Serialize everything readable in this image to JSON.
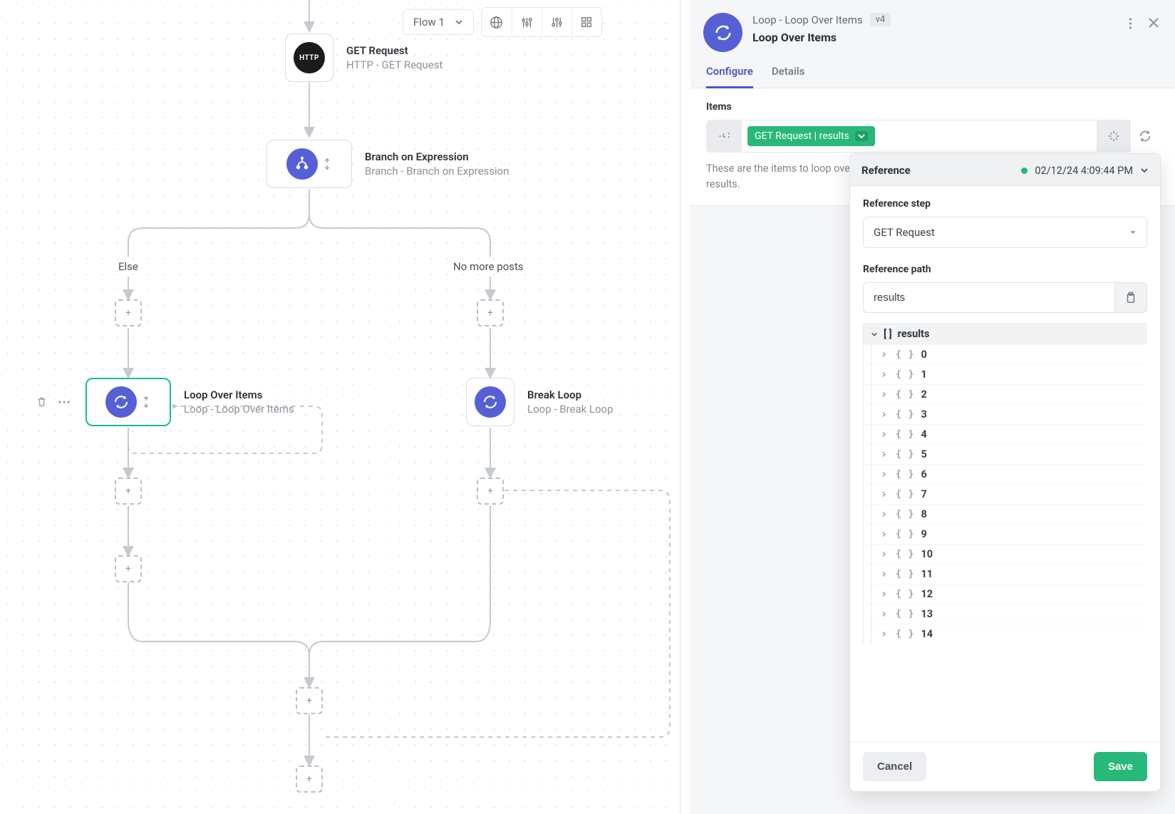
{
  "toolbar": {
    "flow_label": "Flow 1"
  },
  "nodes": {
    "http": {
      "title": "GET Request",
      "sub": "HTTP - GET Request",
      "icon_text": "HTTP"
    },
    "branch": {
      "title": "Branch on Expression",
      "sub": "Branch - Branch on Expression"
    },
    "loop": {
      "title": "Loop Over Items",
      "sub": "Loop - Loop Over Items"
    },
    "break": {
      "title": "Break Loop",
      "sub": "Loop - Break Loop"
    }
  },
  "branch_labels": {
    "else": "Else",
    "no_more": "No more posts"
  },
  "panel": {
    "crumb": "Loop - Loop Over Items",
    "version": "v4",
    "title": "Loop Over Items",
    "tabs": {
      "configure": "Configure",
      "details": "Details"
    },
    "items_label": "Items",
    "items_pill": "GET Request | results",
    "helper": "These are the items to loop over. This is usually a reference to an array from a previous step's results."
  },
  "popover": {
    "title": "Reference",
    "timestamp": "02/12/24 4:09:44 PM",
    "ref_step_label": "Reference step",
    "ref_step_value": "GET Request",
    "ref_path_label": "Reference path",
    "ref_path_value": "results",
    "tree_root": "results",
    "tree_items": [
      "0",
      "1",
      "2",
      "3",
      "4",
      "5",
      "6",
      "7",
      "8",
      "9",
      "10",
      "11",
      "12",
      "13",
      "14"
    ],
    "cancel": "Cancel",
    "save": "Save"
  }
}
